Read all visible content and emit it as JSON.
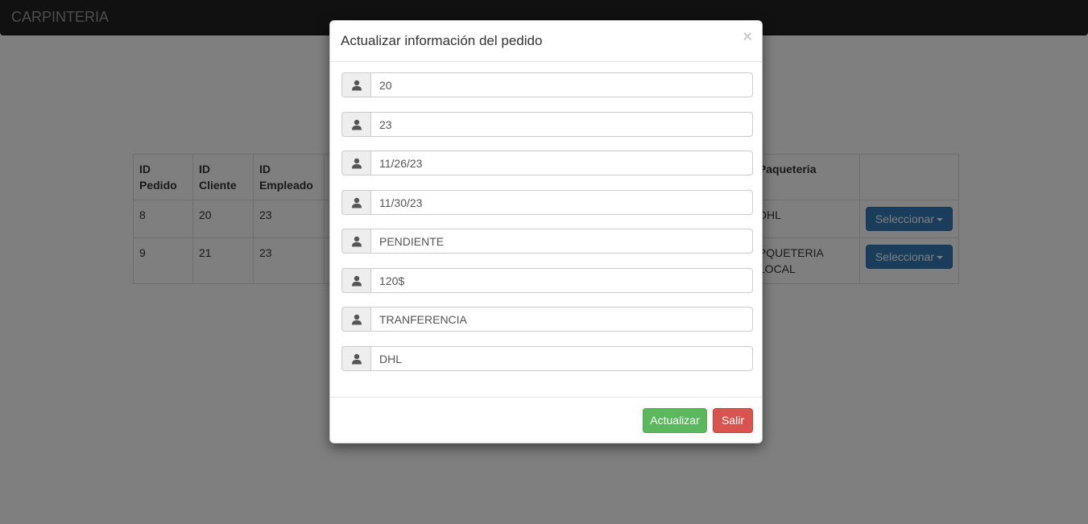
{
  "navbar": {
    "brand": "CARPINTERIA"
  },
  "table": {
    "headers": [
      "ID Pedido",
      "ID Cliente",
      "ID Empleado",
      "",
      "Paqueteria",
      ""
    ],
    "rows": [
      {
        "id_pedido": "8",
        "id_cliente": "20",
        "id_empleado": "23",
        "paqueteria": "DHL",
        "action": "Seleccionar"
      },
      {
        "id_pedido": "9",
        "id_cliente": "21",
        "id_empleado": "23",
        "paqueteria": "PQUETERIA LOCAL",
        "action": "Seleccionar"
      }
    ]
  },
  "modal": {
    "title": "Actualizar información del pedido",
    "close": "×",
    "icon": "user-icon",
    "fields": [
      {
        "value": "20"
      },
      {
        "value": "23"
      },
      {
        "value": "11/26/23"
      },
      {
        "value": "11/30/23"
      },
      {
        "value": "PENDIENTE"
      },
      {
        "value": "120$"
      },
      {
        "value": "TRANFERENCIA"
      },
      {
        "value": "DHL"
      }
    ],
    "buttons": {
      "update": "Actualizar",
      "exit": "Salir"
    }
  },
  "colors": {
    "navbar": "#222222",
    "primary": "#337ab7",
    "success": "#5cb85c",
    "danger": "#d9534f"
  }
}
